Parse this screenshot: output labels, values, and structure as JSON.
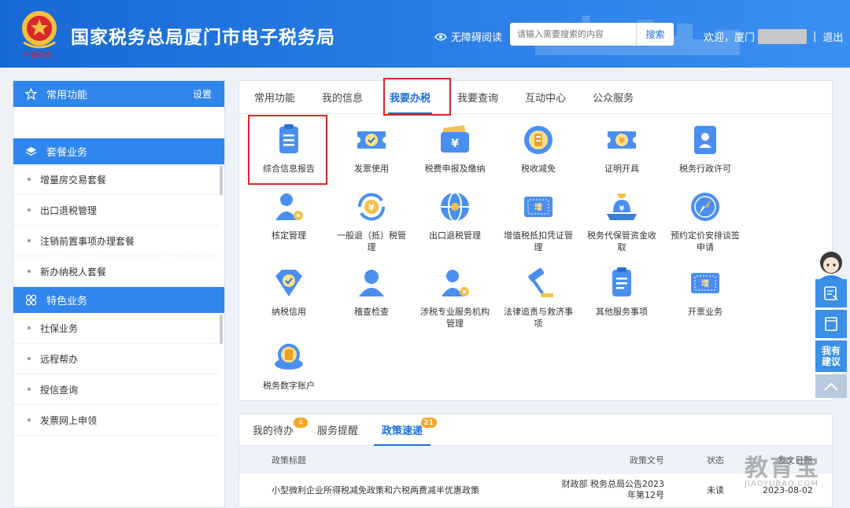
{
  "header": {
    "title": "国家税务总局厦门市电子税务局",
    "accessibility": "无障碍阅读",
    "search_placeholder": "请输入需要搜索的内容",
    "search_button": "搜索",
    "welcome": "欢迎，厦门",
    "separator": "|",
    "logout": "退出"
  },
  "sidebar": {
    "common": {
      "title": "常用功能",
      "settings": "设置"
    },
    "package": {
      "title": "套餐业务",
      "items": [
        "增量房交易套餐",
        "出口退税管理",
        "注销前置事项办理套餐",
        "新办纳税人套餐"
      ]
    },
    "featured": {
      "title": "特色业务",
      "items": [
        "社保业务",
        "远程帮办",
        "授信查询",
        "发票网上申领"
      ]
    }
  },
  "main": {
    "tabs": [
      "常用功能",
      "我的信息",
      "我要办税",
      "我要查询",
      "互动中心",
      "公众服务"
    ],
    "active_tab": "我要办税",
    "services": [
      {
        "label": "综合信息报告",
        "icon": "clipboard-icon"
      },
      {
        "label": "发票使用",
        "icon": "ticket-check-icon"
      },
      {
        "label": "税费申报及缴纳",
        "icon": "wallet-yuan-icon"
      },
      {
        "label": "税收减免",
        "icon": "coin-stack-icon"
      },
      {
        "label": "证明开具",
        "icon": "yuan-ticket-icon"
      },
      {
        "label": "税务行政许可",
        "icon": "id-card-icon"
      },
      {
        "label": "核定管理",
        "icon": "user-gear-icon"
      },
      {
        "label": "一般退（抵）税管理",
        "icon": "yuan-refresh-icon"
      },
      {
        "label": "出口退税管理",
        "icon": "globe-icon"
      },
      {
        "label": "增值税抵扣凭证管理",
        "icon": "vat-voucher-icon"
      },
      {
        "label": "税务代保管资金收取",
        "icon": "money-bag-icon"
      },
      {
        "label": "预约定价安排谈签申请",
        "icon": "compass-icon"
      },
      {
        "label": "纳税信用",
        "icon": "diamond-check-icon"
      },
      {
        "label": "稽查检查",
        "icon": "user-icon"
      },
      {
        "label": "涉税专业服务机构管理",
        "icon": "user-gear-icon"
      },
      {
        "label": "法律追责与救济事项",
        "icon": "gavel-icon"
      },
      {
        "label": "其他服务事项",
        "icon": "clipboard-list-icon"
      },
      {
        "label": "开票业务",
        "icon": "vat-invoice-icon"
      },
      {
        "label": "税务数字账户",
        "icon": "coin-stack-icon"
      }
    ]
  },
  "bottom": {
    "tabs": [
      {
        "label": "我的待办",
        "badge": "4"
      },
      {
        "label": "服务提醒",
        "badge": ""
      },
      {
        "label": "政策速递",
        "badge": "21"
      }
    ],
    "columns": [
      "政策标题",
      "政策文号",
      "状态",
      "发文日期"
    ],
    "rows": [
      {
        "title": "小型微利企业所得税减免政策和六税两费减半优惠政策",
        "doc_no_1": "财政部 税务总局公告2023",
        "doc_no_2": "年第12号",
        "status": "未读",
        "date": "2023-08-02"
      }
    ]
  },
  "floating": {
    "suggest_1": "我有",
    "suggest_2": "建议"
  },
  "watermark": {
    "big": "教育宝",
    "small": "JIAOYUBAO.COM"
  },
  "colors": {
    "brand_blue": "#1d6fd8",
    "highlight_red": "#d9262c",
    "badge_orange": "#f5a623"
  }
}
